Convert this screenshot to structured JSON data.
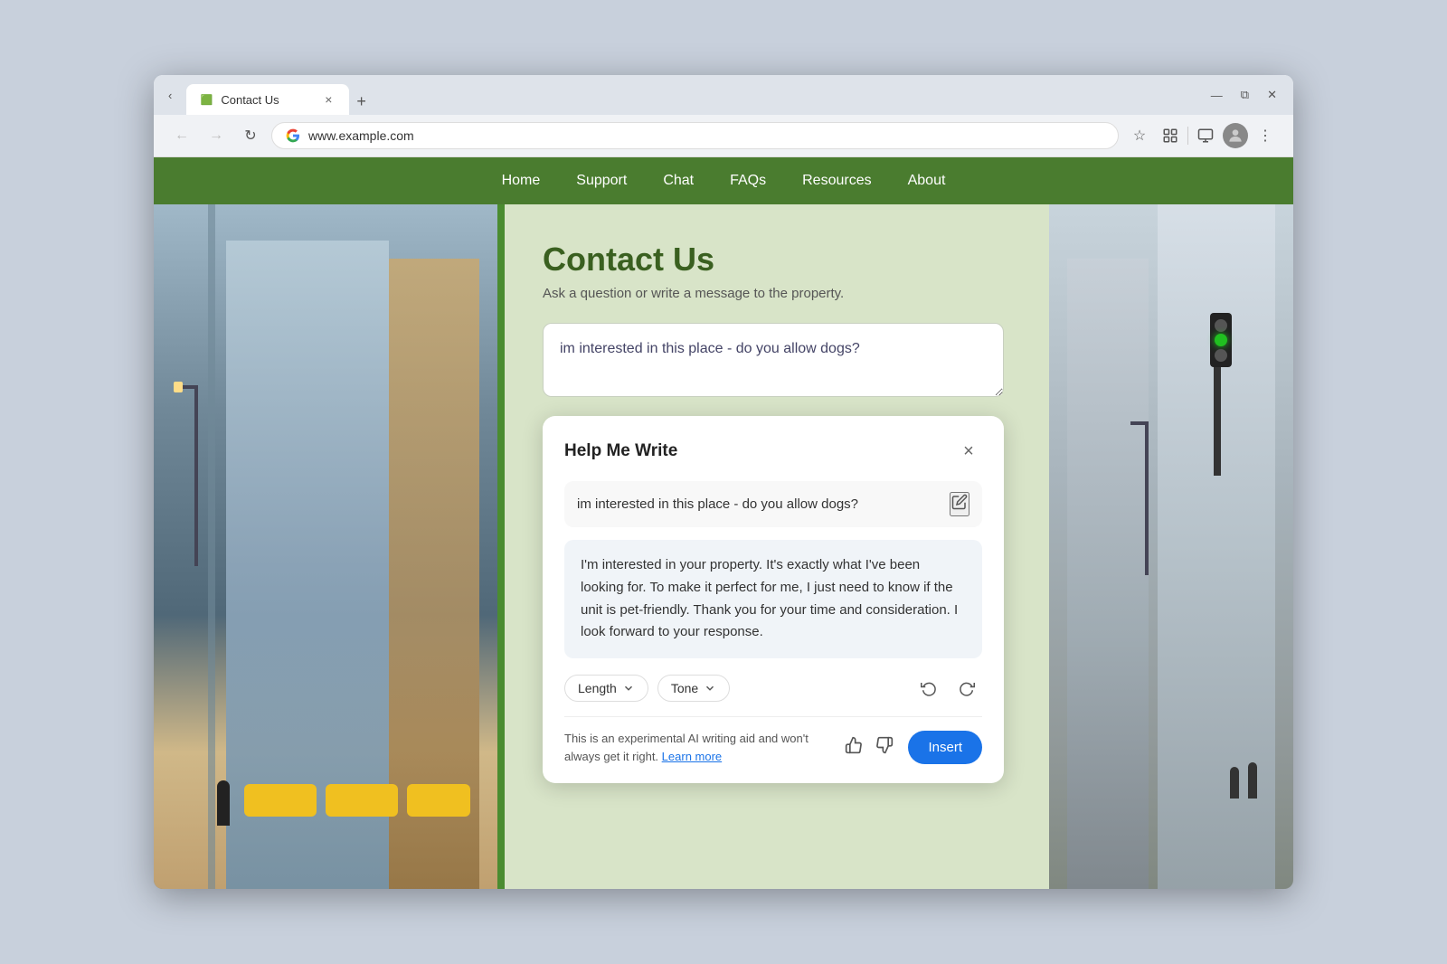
{
  "browser": {
    "tab_title": "Contact Us",
    "tab_favicon": "🟩",
    "address": "www.example.com",
    "new_tab_label": "+",
    "close_label": "×",
    "nav_back": "←",
    "nav_forward": "→",
    "nav_reload": "↻",
    "window_minimize": "—",
    "window_restore": "⧉",
    "window_close": "✕"
  },
  "nav": {
    "links": [
      {
        "label": "Home",
        "id": "home"
      },
      {
        "label": "Support",
        "id": "support"
      },
      {
        "label": "Chat",
        "id": "chat"
      },
      {
        "label": "FAQs",
        "id": "faqs"
      },
      {
        "label": "Resources",
        "id": "resources"
      },
      {
        "label": "About",
        "id": "about"
      }
    ]
  },
  "contact_page": {
    "title": "Contact Us",
    "subtitle": "Ask a question or write a message to the property.",
    "textarea_value": "im interested in this place - do you allow dogs?"
  },
  "help_me_write": {
    "title": "Help Me Write",
    "close_label": "×",
    "input_text": "im interested in this place - do you allow dogs?",
    "generated_text": "I'm interested in your property. It's exactly what I've been looking for. To make it perfect for me, I just need to know if the unit is pet-friendly. Thank you for your time and consideration. I look forward to your response.",
    "length_label": "Length",
    "tone_label": "Tone",
    "footer_text": "This is an experimental AI writing aid and won't always get it right.",
    "learn_more_label": "Learn more",
    "insert_label": "Insert"
  }
}
